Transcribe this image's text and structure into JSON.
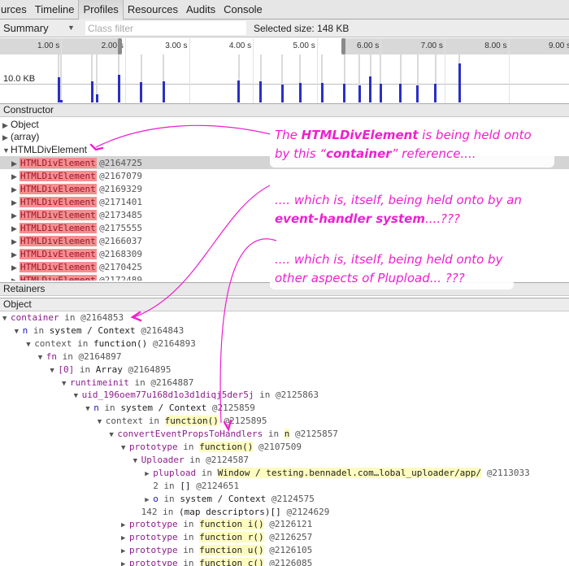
{
  "tabs": [
    {
      "label": "urces",
      "active": false
    },
    {
      "label": "Timeline",
      "active": false
    },
    {
      "label": "Profiles",
      "active": true
    },
    {
      "label": "Resources",
      "active": false
    },
    {
      "label": "Audits",
      "active": false
    },
    {
      "label": "Console",
      "active": false
    }
  ],
  "toolbar": {
    "view_select": "Summary",
    "class_filter_placeholder": "Class filter",
    "selected_size": "Selected size: 148 KB"
  },
  "timeline": {
    "ticks": [
      "1.00 s",
      "2.00 s",
      "3.00 s",
      "4.00 s",
      "5.00 s",
      "6.00 s",
      "7.00 s",
      "8.00 s",
      "9.00 s"
    ],
    "y_label": "10.0 KB",
    "selection_range_s": [
      1.95,
      5.45
    ],
    "allocations": [
      {
        "t": 0.98,
        "kb": 13.5
      },
      {
        "t": 1.02,
        "kb": 1.5
      },
      {
        "t": 1.5,
        "kb": 11.5
      },
      {
        "t": 1.58,
        "kb": 4.2
      },
      {
        "t": 1.92,
        "kb": 15.0
      },
      {
        "t": 2.27,
        "kb": 10.8
      },
      {
        "t": 2.62,
        "kb": 11.5
      },
      {
        "t": 3.8,
        "kb": 11.8
      },
      {
        "t": 4.14,
        "kb": 11.5
      },
      {
        "t": 4.48,
        "kb": 9.7
      },
      {
        "t": 4.76,
        "kb": 10.3
      },
      {
        "t": 5.1,
        "kb": 10.3
      },
      {
        "t": 5.45,
        "kb": 10.0
      },
      {
        "t": 5.69,
        "kb": 9.2
      },
      {
        "t": 5.86,
        "kb": 14.0
      },
      {
        "t": 6.02,
        "kb": 10.0
      },
      {
        "t": 6.33,
        "kb": 10.0
      },
      {
        "t": 6.6,
        "kb": 9.3
      },
      {
        "t": 6.88,
        "kb": 10.0
      },
      {
        "t": 7.25,
        "kb": 21.0
      }
    ]
  },
  "constructor_panel": {
    "header": "Constructor",
    "groups": [
      {
        "name": "Object",
        "expanded": false
      },
      {
        "name": "(array)",
        "expanded": false
      },
      {
        "name": "HTMLDivElement",
        "expanded": true
      }
    ],
    "instances": [
      {
        "name": "HTMLDivElement",
        "id": "@2164725",
        "selected": true
      },
      {
        "name": "HTMLDivElement",
        "id": "@2167079"
      },
      {
        "name": "HTMLDivElement",
        "id": "@2169329"
      },
      {
        "name": "HTMLDivElement",
        "id": "@2171401"
      },
      {
        "name": "HTMLDivElement",
        "id": "@2173485"
      },
      {
        "name": "HTMLDivElement",
        "id": "@2175555"
      },
      {
        "name": "HTMLDivElement",
        "id": "@2166037"
      },
      {
        "name": "HTMLDivElement",
        "id": "@2168309"
      },
      {
        "name": "HTMLDivElement",
        "id": "@2170425"
      },
      {
        "name": "HTMLDivElement",
        "id": "@2172489"
      }
    ]
  },
  "retainers_panel": {
    "header": "Retainers",
    "column": "Object",
    "in": "in",
    "rows": [
      {
        "depth": 0,
        "tri": "down",
        "prop": "container",
        "ctx": "",
        "id": "@2164853"
      },
      {
        "depth": 1,
        "tri": "down",
        "prop": "n",
        "blue": true,
        "ctx": "system / Context",
        "id": "@2164843"
      },
      {
        "depth": 2,
        "tri": "down",
        "prop": "context",
        "plain": true,
        "ctx": "function()",
        "id": "@2164893"
      },
      {
        "depth": 3,
        "tri": "down",
        "prop": "fn",
        "ctx": "",
        "id": "@2164897"
      },
      {
        "depth": 4,
        "tri": "down",
        "prop": "[0]",
        "ctx": "Array",
        "id": "@2164895"
      },
      {
        "depth": 5,
        "tri": "down",
        "prop": "runtimeinit",
        "ctx": "",
        "id": "@2164887"
      },
      {
        "depth": 6,
        "tri": "down",
        "prop": "uid_196oem77u168d1o3d1diqj5der5j",
        "ctx": "",
        "id": "@2125863"
      },
      {
        "depth": 7,
        "tri": "down",
        "prop": "n",
        "blue": true,
        "ctx": "system / Context",
        "id": "@2125859"
      },
      {
        "depth": 8,
        "tri": "down",
        "prop": "context",
        "plain": true,
        "ctx": "function()",
        "ctx_hl": true,
        "id": "@2125895"
      },
      {
        "depth": 9,
        "tri": "down",
        "prop": "convertEventPropsToHandlers",
        "ctx": "n",
        "ctx_hl": true,
        "id": "@2125857"
      },
      {
        "depth": 10,
        "tri": "down",
        "prop": "prototype",
        "ctx": "function()",
        "ctx_hl": true,
        "id": "@2107509"
      },
      {
        "depth": 11,
        "tri": "down",
        "prop": "Uploader",
        "ctx": "",
        "id": "@2124587"
      },
      {
        "depth": 12,
        "tri": "right",
        "prop": "plupload",
        "ctx": "Window / testing.bennadel.com…lobal_uploader/app/",
        "ctx_hl": true,
        "id": "@2113033"
      },
      {
        "depth": 12,
        "tri": "none",
        "prop": "2",
        "plain": true,
        "ctx": "[]",
        "id": "@2124651"
      },
      {
        "depth": 12,
        "tri": "right",
        "prop": "o",
        "blue": true,
        "ctx": "system / Context",
        "id": "@2124575"
      },
      {
        "depth": 11,
        "tri": "none",
        "prop": "142",
        "plain": true,
        "ctx": "(map descriptors)[]",
        "id": "@2124629"
      },
      {
        "depth": 10,
        "tri": "right",
        "prop": "prototype",
        "ctx": "function i()",
        "ctx_hl": true,
        "id": "@2126121"
      },
      {
        "depth": 10,
        "tri": "right",
        "prop": "prototype",
        "ctx": "function r()",
        "ctx_hl": true,
        "id": "@2126257"
      },
      {
        "depth": 10,
        "tri": "right",
        "prop": "prototype",
        "ctx": "function u()",
        "ctx_hl": true,
        "id": "@2126105"
      },
      {
        "depth": 10,
        "tri": "right",
        "prop": "prototype",
        "ctx": "function c()",
        "ctx_hl": true,
        "id": "@2126085"
      }
    ]
  },
  "annotations": {
    "note1_a": "The ",
    "note1_b": "HTMLDivElement",
    "note1_c": " is being held onto",
    "note1_d": "by this “",
    "note1_e": "container",
    "note1_f": "” reference....",
    "note2_a": ".... which is, itself, being held onto by an",
    "note2_b": "event-handler system",
    "note2_c": "....???",
    "note3_a": ".... which is, itself, being held onto by",
    "note3_b": "other aspects of Plupload... ???",
    "color": "#ef1fcf"
  }
}
